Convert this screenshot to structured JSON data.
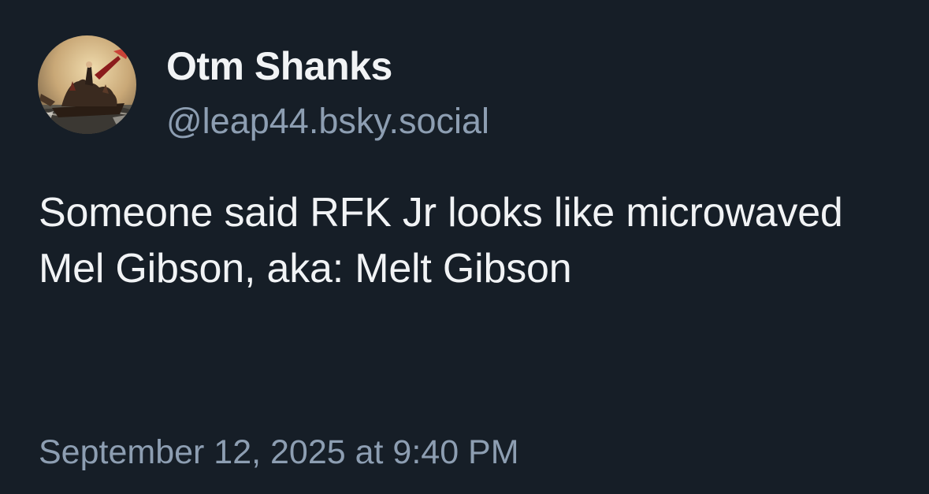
{
  "author": {
    "display_name": "Otm Shanks",
    "handle": "@leap44.bsky.social",
    "avatar_icon": "painting-avatar-icon"
  },
  "post": {
    "text": "Someone said RFK Jr looks like microwaved Mel Gibson, aka: Melt Gibson",
    "timestamp": "September 12, 2025 at 9:40 PM"
  },
  "colors": {
    "background": "#161e27",
    "primary_text": "#f1f3f5",
    "secondary_text": "#8d9eb2"
  }
}
